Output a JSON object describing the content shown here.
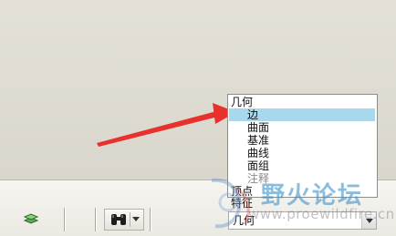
{
  "geometry_dropdown": {
    "items": [
      {
        "label": "几何",
        "indent": 0,
        "selected": false,
        "muted": false
      },
      {
        "label": "边",
        "indent": 1,
        "selected": true,
        "muted": false
      },
      {
        "label": "曲面",
        "indent": 1,
        "selected": false,
        "muted": false
      },
      {
        "label": "基准",
        "indent": 1,
        "selected": false,
        "muted": false
      },
      {
        "label": "曲线",
        "indent": 1,
        "selected": false,
        "muted": false
      },
      {
        "label": "面组",
        "indent": 1,
        "selected": false,
        "muted": false
      },
      {
        "label": "注释",
        "indent": 1,
        "selected": false,
        "muted": true
      },
      {
        "label": "顶点",
        "indent": 0,
        "selected": false,
        "muted": false
      },
      {
        "label": "特征",
        "indent": 0,
        "selected": false,
        "muted": false
      }
    ],
    "current_value": "几何"
  },
  "toolbar": {
    "icons": [
      "layer-icon",
      "binoculars-icon",
      "chevron-down-icon"
    ]
  },
  "watermark": {
    "title": "野火论坛",
    "url": "www.proewildfire.cn"
  },
  "annotation": {
    "arrow_color": "#e8312c"
  }
}
